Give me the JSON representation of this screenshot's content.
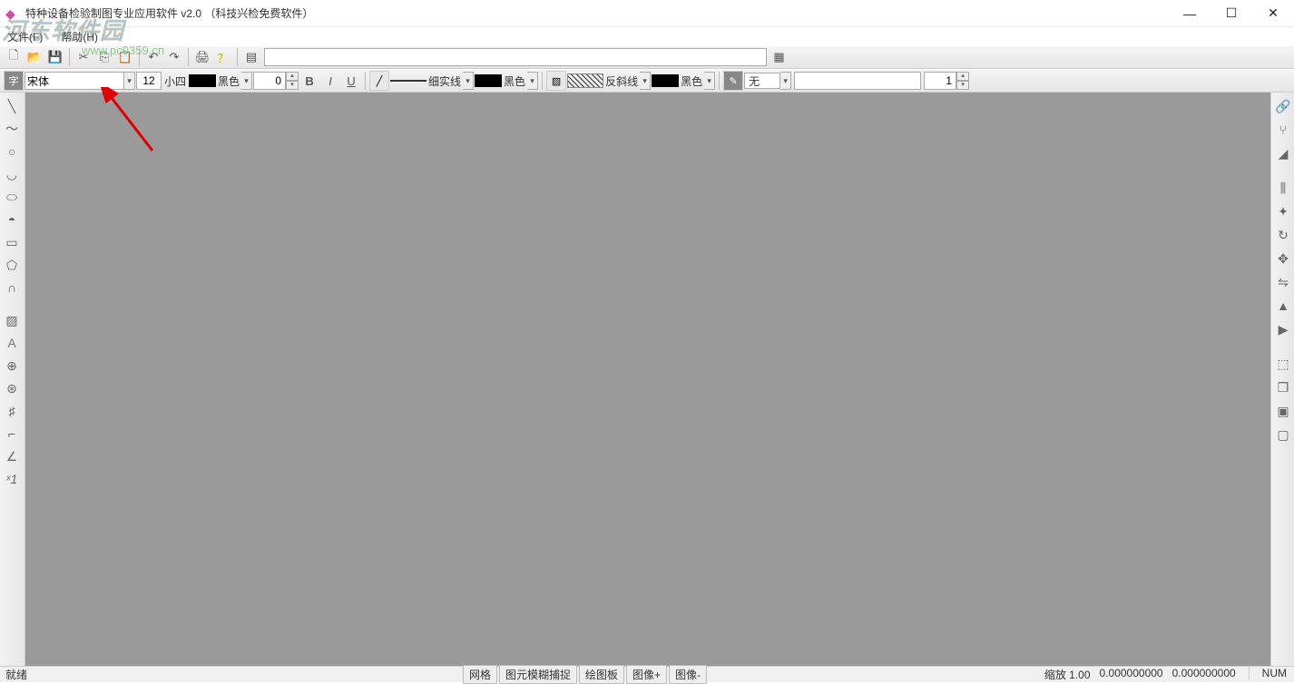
{
  "window": {
    "title": "特种设备检验制图专业应用软件 v2.0 （科技兴检免费软件）"
  },
  "menubar": {
    "file": "文件(F)",
    "help": "帮助(H)"
  },
  "watermark": {
    "logo": "河东软件园",
    "url": "www.pc0359.cn"
  },
  "toolbar2": {
    "font_name": "宋体",
    "font_size": "12",
    "size_label": "小四",
    "text_color_label": "黑色",
    "line_value": "0",
    "line_style_label": "细实线",
    "line_color_label": "黑色",
    "hatch_label": "反斜线",
    "hatch_color_label": "黑色",
    "fill_label": "无",
    "spin_value": "1",
    "bold": "B",
    "italic": "I",
    "underline": "U"
  },
  "statusbar": {
    "ready": "就绪",
    "grid": "网格",
    "snap": "图元模糊捕捉",
    "board": "绘图板",
    "img_plus": "图像+",
    "img_minus": "图像-",
    "zoom": "缩放 1.00",
    "coord_x": "0.000000000",
    "coord_y": "0.000000000",
    "num": "NUM"
  }
}
